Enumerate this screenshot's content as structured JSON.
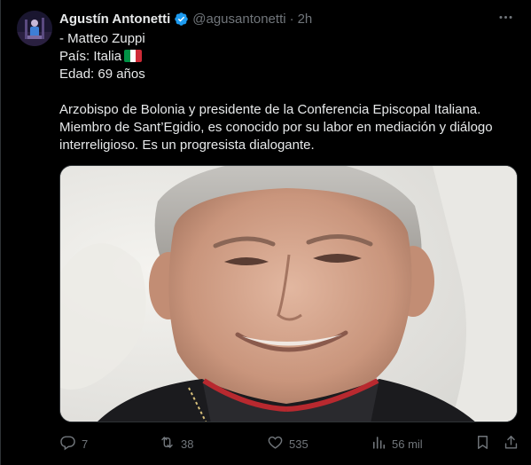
{
  "tweet": {
    "display_name": "Agustín Antonetti",
    "handle": "@agusantonetti",
    "separator": "·",
    "time": "2h",
    "lines": [
      "- Matteo Zuppi",
      "País: Italia",
      "Edad: 69 años"
    ],
    "paragraph_lines": [
      "Arzobispo de Bolonia y presidente de la Conferencia Episcopal Italiana.",
      "Miembro de Sant’Egidio, es conocido por su labor en mediación y diálogo",
      "interreligioso. Es un progresista dialogante."
    ],
    "flag_colors": [
      "#009246",
      "#ffffff",
      "#ce2b37"
    ]
  },
  "actions": {
    "reply_count": "7",
    "retweet_count": "38",
    "like_count": "535",
    "views_count": "56 mil"
  },
  "colors": {
    "background": "#000000",
    "text": "#e7e9ea",
    "muted": "#71767b",
    "verified": "#1d9bf0",
    "border": "#2f3336"
  },
  "icons": {
    "more": "more-icon",
    "verified": "verified-badge-icon",
    "reply": "reply-icon",
    "retweet": "retweet-icon",
    "like": "like-icon",
    "views": "views-icon",
    "bookmark": "bookmark-icon",
    "share": "share-icon"
  }
}
